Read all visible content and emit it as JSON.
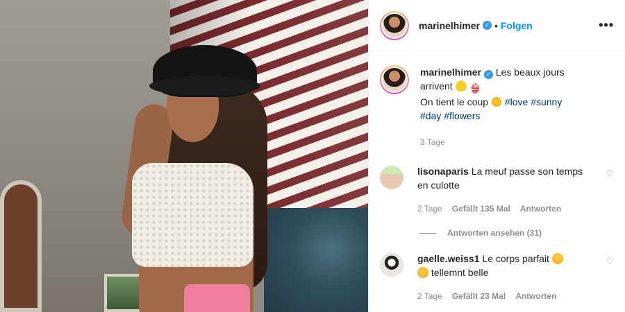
{
  "post": {
    "author": "marinelhimer",
    "verified_icon": "verified-badge-icon",
    "separator": "•",
    "follow_label": "Folgen",
    "more_label": "•••",
    "caption": {
      "line1_text": "Les beaux jours",
      "line2_text": "arrivent",
      "line3_text": "On tient le coup",
      "hashtags_line3": [
        "#love",
        "#sunny"
      ],
      "hashtags_line4": [
        "#day",
        "#flowers"
      ],
      "time": "3 Tage"
    }
  },
  "comments": [
    {
      "username": "lisonaparis",
      "text": "La meuf passe son temps en culotte",
      "time": "2 Tage",
      "likes": "Gefällt 135 Mal",
      "reply_label": "Antworten",
      "view_replies": "Antworten ansehen (31)"
    },
    {
      "username": "gaelle.weiss1",
      "text_part1": "Le corps parfait",
      "text_part2": "tellemnt belle",
      "time": "2 Tage",
      "likes": "Gefällt 23 Mal",
      "reply_label": "Antworten"
    }
  ],
  "colors": {
    "link_blue": "#0095f6",
    "hashtag": "#00376b",
    "secondary_text": "#8e8e8e",
    "verified": "#3897f0"
  }
}
